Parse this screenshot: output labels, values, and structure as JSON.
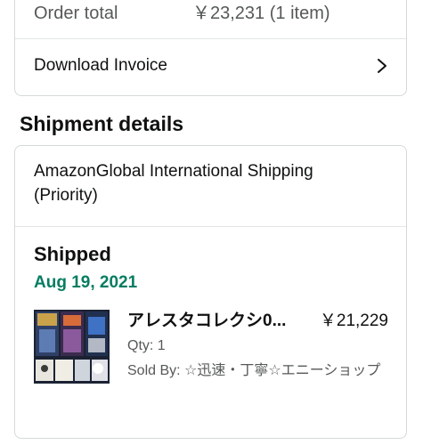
{
  "order_summary": {
    "order_total_label": "Order total",
    "order_total_value": "￥23,231 (1 item)",
    "download_invoice_label": "Download Invoice"
  },
  "shipment": {
    "section_title": "Shipment details",
    "method": "AmazonGlobal International Shipping (Priority)",
    "status": "Shipped",
    "status_date": "Aug 19, 2021",
    "status_date_color": "#067d62",
    "item": {
      "title": "アレスタコレクシ0...",
      "price": "￥21,229",
      "qty": "Qty: 1",
      "sold_by": "Sold By: ☆迅速・丁寧☆エニーショップ"
    }
  }
}
